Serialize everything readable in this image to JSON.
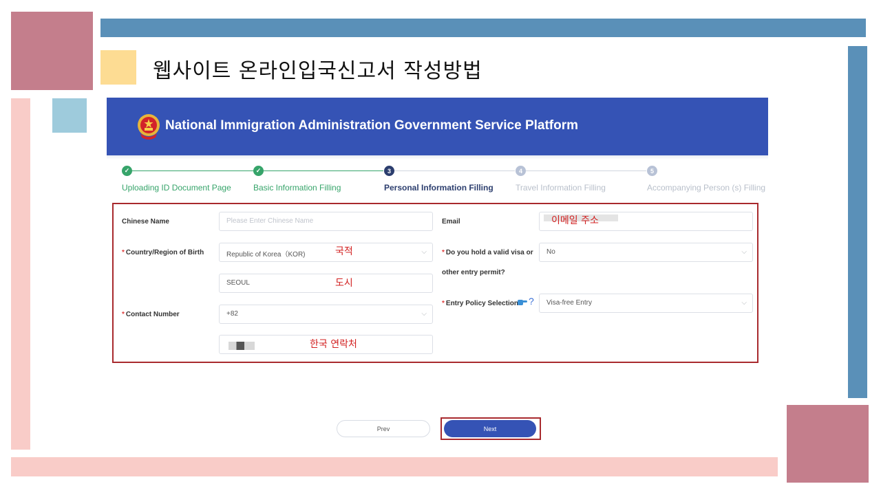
{
  "slide": {
    "title": "웹사이트 온라인입국신고서 작성방법",
    "colors": {
      "mauve": "#c47e8c",
      "blue_bar": "#5a90b8",
      "pink": "#f9ccc8",
      "yellow": "#fddc93",
      "light_blue": "#9ecbdc",
      "annotation_red": "#d22020"
    }
  },
  "portal": {
    "header": {
      "title": "National Immigration Administration Government Service Platform",
      "emblem_icon": "national-emblem-icon",
      "bg_color": "#3553b5"
    },
    "steps": [
      {
        "number": "1",
        "label": "Uploading ID Document Page",
        "state": "done"
      },
      {
        "number": "2",
        "label": "Basic Information Filling",
        "state": "done"
      },
      {
        "number": "3",
        "label": "Personal Information Filling",
        "state": "active"
      },
      {
        "number": "4",
        "label": "Travel Information Filling",
        "state": "pending"
      },
      {
        "number": "5",
        "label": "Accompanying Person (s) Filling",
        "state": "pending"
      }
    ],
    "form": {
      "chinese_name": {
        "label": "Chinese Name",
        "placeholder": "Please Enter Chinese Name"
      },
      "birth_country": {
        "required_mark": "*",
        "label": "Country/Region of Birth",
        "value": "Republic of Korea（KOR)"
      },
      "birth_city": {
        "value": "SEOUL"
      },
      "contact": {
        "required_mark": "*",
        "label": "Contact Number",
        "code": "+82"
      },
      "email": {
        "label": "Email"
      },
      "visa": {
        "required_mark": "*",
        "label_line1": "Do you hold a valid visa or",
        "label_line2": "other entry permit?",
        "value": "No"
      },
      "entry_policy": {
        "required_mark": "*",
        "label": "Entry Policy Selection",
        "value": "Visa-free Entry",
        "hint_icon": "pointing-hand-icon",
        "help_icon": "question-mark-icon"
      }
    },
    "annotations": {
      "email": "이메일 주소",
      "nationality": "국적",
      "city": "도시",
      "phone": "한국 연락처"
    },
    "buttons": {
      "prev": "Prev",
      "next": "Next"
    }
  }
}
